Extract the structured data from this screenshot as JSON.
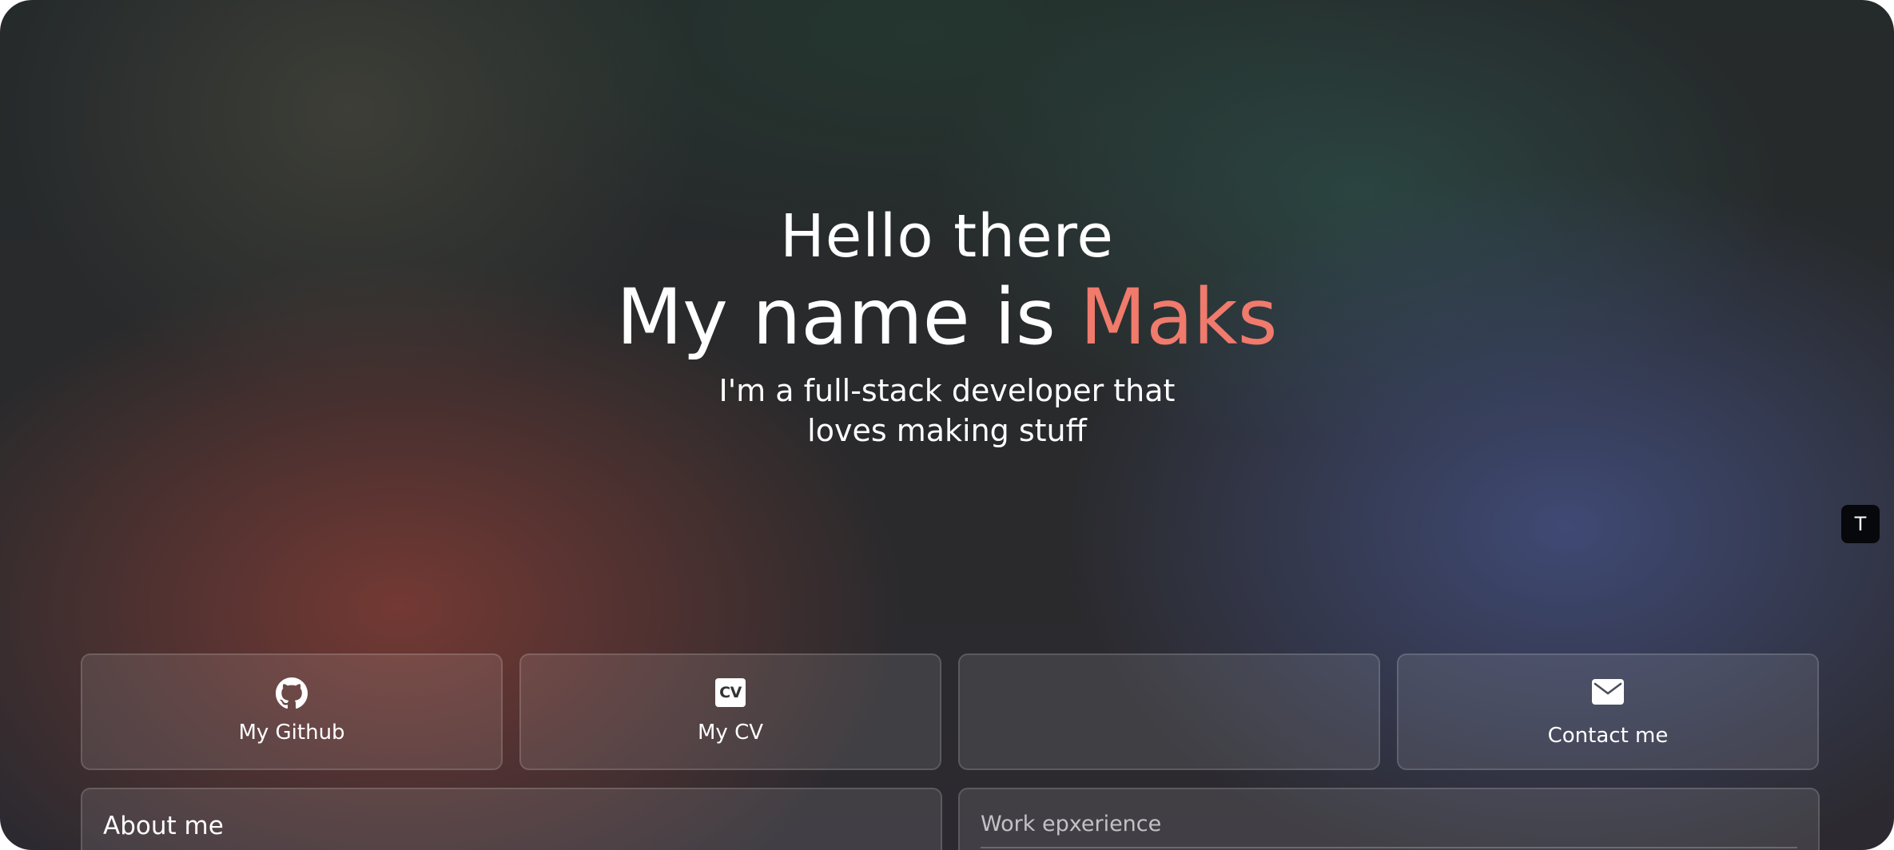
{
  "hero": {
    "greeting": "Hello there",
    "name_prefix": "My name is ",
    "name": "Maks",
    "tagline_line1": "I'm a full-stack developer that",
    "tagline_line2": "loves making stuff"
  },
  "theme_toggle": {
    "label": "T"
  },
  "links": {
    "github": {
      "label": "My Github",
      "icon": "github-icon"
    },
    "cv": {
      "label": "My CV",
      "icon_text": "CV",
      "icon": "cv-icon"
    },
    "empty": {
      "label": ""
    },
    "contact": {
      "label": "Contact me",
      "icon": "mail-icon"
    }
  },
  "sections": {
    "about": {
      "title": "About me"
    },
    "work": {
      "title": "Work epxerience"
    }
  },
  "colors": {
    "accent": "#f07a6c",
    "text": "#ffffff"
  }
}
